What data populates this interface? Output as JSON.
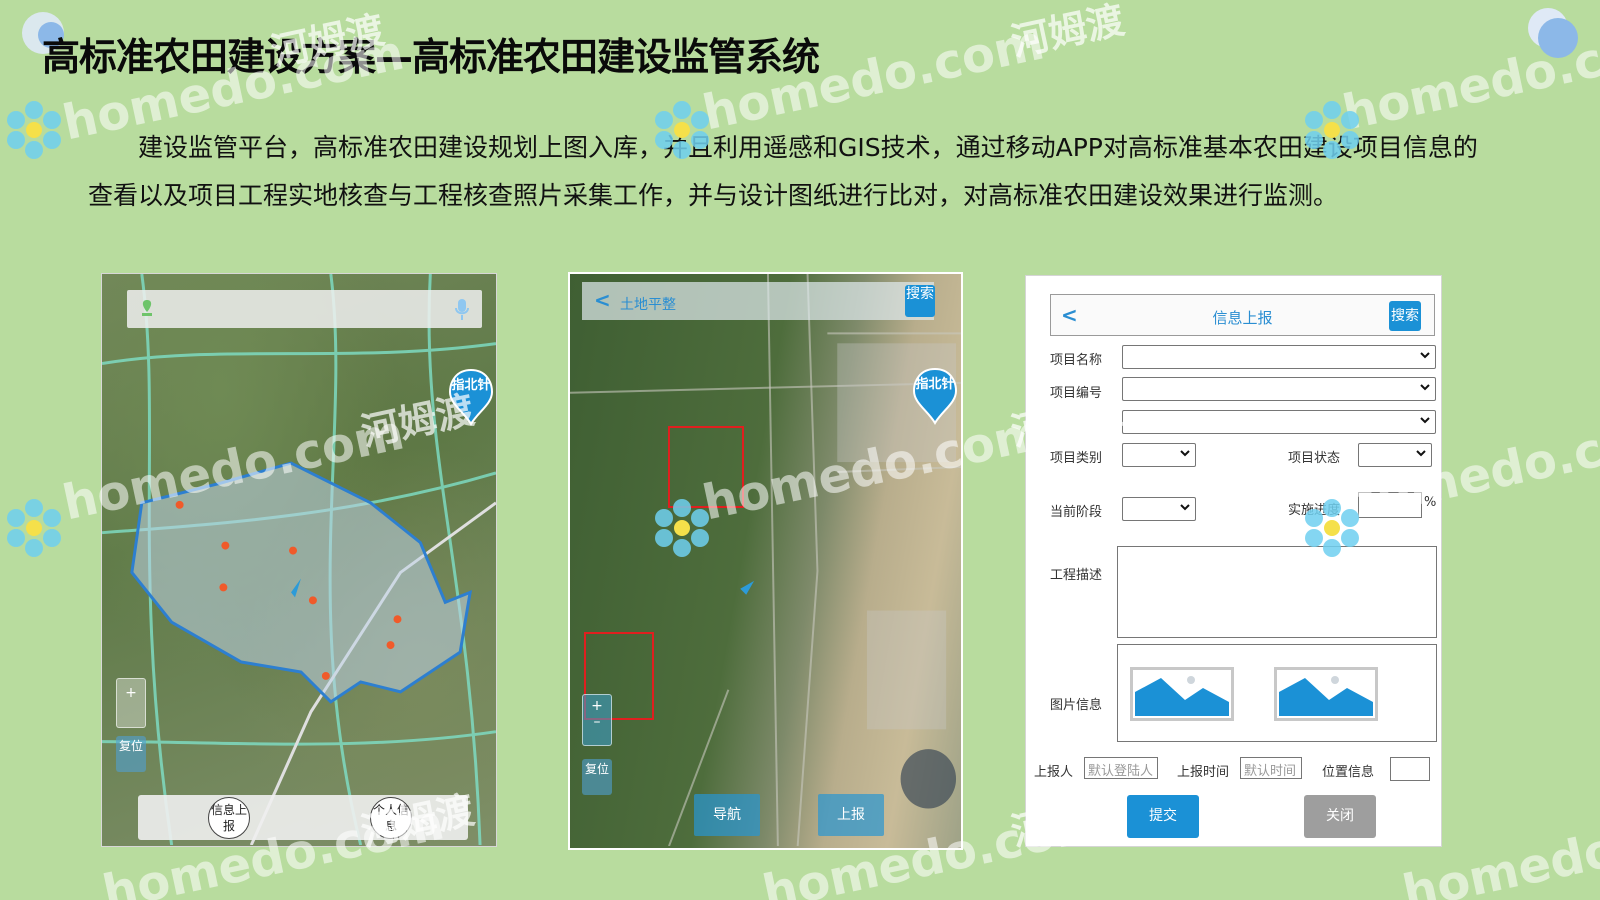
{
  "title": "高标准农田建设方案—高标准农田建设监管系统",
  "intro": "建设监管平台，高标准农田建设规划上图入库，并且利用遥感和GIS技术，通过移动APP对高标准基本农田建设项目信息的查看以及项目工程实地核查与工程核查照片采集工作，并与设计图纸进行比对，对高标准农田建设效果进行监测。",
  "watermark": {
    "brand": "homedo.com",
    "cn": "河姆渡"
  },
  "phone1": {
    "compass_label": "指北针",
    "zoom_in": "+",
    "reset_label": "复位",
    "btn_report": "信息上报",
    "btn_personal": "个人信息"
  },
  "phone2": {
    "back": "<",
    "title": "土地平整",
    "search": "搜索",
    "compass_label": "指北针",
    "zoom_in": "+",
    "zoom_out": "–",
    "reset_label": "复位",
    "btn_nav": "导航",
    "btn_upload": "上报"
  },
  "form": {
    "back": "<",
    "title": "信息上报",
    "search": "搜索",
    "labels": {
      "project_name": "项目名称",
      "project_no": "项目编号",
      "project_type": "项目类别",
      "project_status": "项目状态",
      "current_stage": "当前阶段",
      "progress": "实施进度",
      "description": "工程描述",
      "images": "图片信息",
      "reporter": "上报人",
      "report_time": "上报时间",
      "location": "位置信息"
    },
    "placeholders": {
      "reporter": "默认登陆人",
      "report_time": "默认时间"
    },
    "percent": "%",
    "submit": "提交",
    "close": "关闭"
  },
  "colors": {
    "background": "#b8dc9e",
    "accent_blue": "#1b91d6",
    "close_gray": "#9e9e9e",
    "red_box": "#e01f1f"
  }
}
